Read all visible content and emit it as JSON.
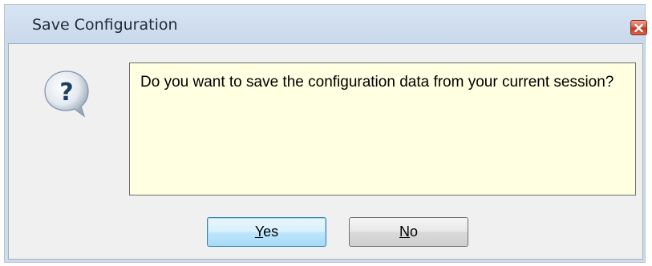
{
  "dialog": {
    "title": "Save Configuration",
    "message": "Do you want to save the configuration data from your current session?",
    "icon": "question-mark-icon",
    "close_icon": "close-icon",
    "buttons": {
      "yes": {
        "mnemonic": "Y",
        "rest": "es"
      },
      "no": {
        "mnemonic": "N",
        "rest": "o"
      }
    }
  },
  "colors": {
    "message_background": "#ffffe1",
    "close_button": "#c9442a",
    "default_button_border": "#3c7fb1"
  }
}
